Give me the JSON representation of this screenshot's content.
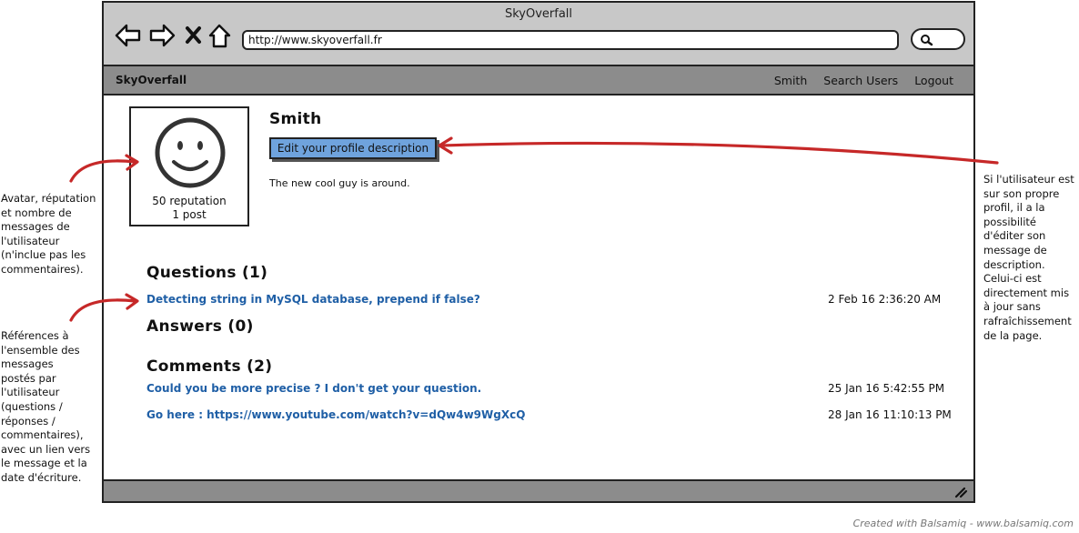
{
  "window": {
    "title": "SkyOverfall",
    "url": "http://www.skyoverfall.fr"
  },
  "appbar": {
    "brand": "SkyOverfall",
    "links": [
      "Smith",
      "Search Users",
      "Logout"
    ]
  },
  "profile": {
    "username": "Smith",
    "reputation": "50 reputation",
    "posts": "1 post",
    "edit_button": "Edit your profile description",
    "description": "The new cool guy is around."
  },
  "questions": {
    "title": "Questions (1)",
    "items": [
      {
        "text": "Detecting string in MySQL database, prepend if false?",
        "date": "2 Feb 16 2:36:20 AM"
      }
    ]
  },
  "answers": {
    "title": "Answers (0)"
  },
  "comments": {
    "title": "Comments (2)",
    "items": [
      {
        "text": "Could you be more precise ? I don't get your question.",
        "date": "25 Jan 16 5:42:55 PM"
      },
      {
        "text": "Go here : https://www.youtube.com/watch?v=dQw4w9WgXcQ",
        "date": "28 Jan 16 11:10:13 PM"
      }
    ]
  },
  "annotations": {
    "avatar": [
      "Avatar, réputation",
      "et nombre de",
      "messages de",
      "l'utilisateur",
      "(n'inclue pas les",
      "commentaires)."
    ],
    "references": [
      "Références à",
      "l'ensemble des",
      "messages",
      "postés par",
      "l'utilisateur",
      "(questions /",
      "réponses /",
      "commentaires),",
      "avec un lien vers",
      "le message et la",
      "date d'écriture."
    ],
    "edit": [
      "Si l'utilisateur est",
      "sur son propre",
      "profil, il a la",
      "possibilité",
      "d'éditer son",
      "message de",
      "description.",
      "Celui-ci est",
      "directement mis",
      "à jour sans",
      "rafraîchissement",
      "de la page."
    ]
  },
  "watermark": "Created with Balsamiq - www.balsamiq.com",
  "colors": {
    "link": "#1f5fa6",
    "button": "#6fa3dd",
    "arrow": "#c62828",
    "bar": "#8c8c8c",
    "titlebar": "#c8c8c8"
  }
}
